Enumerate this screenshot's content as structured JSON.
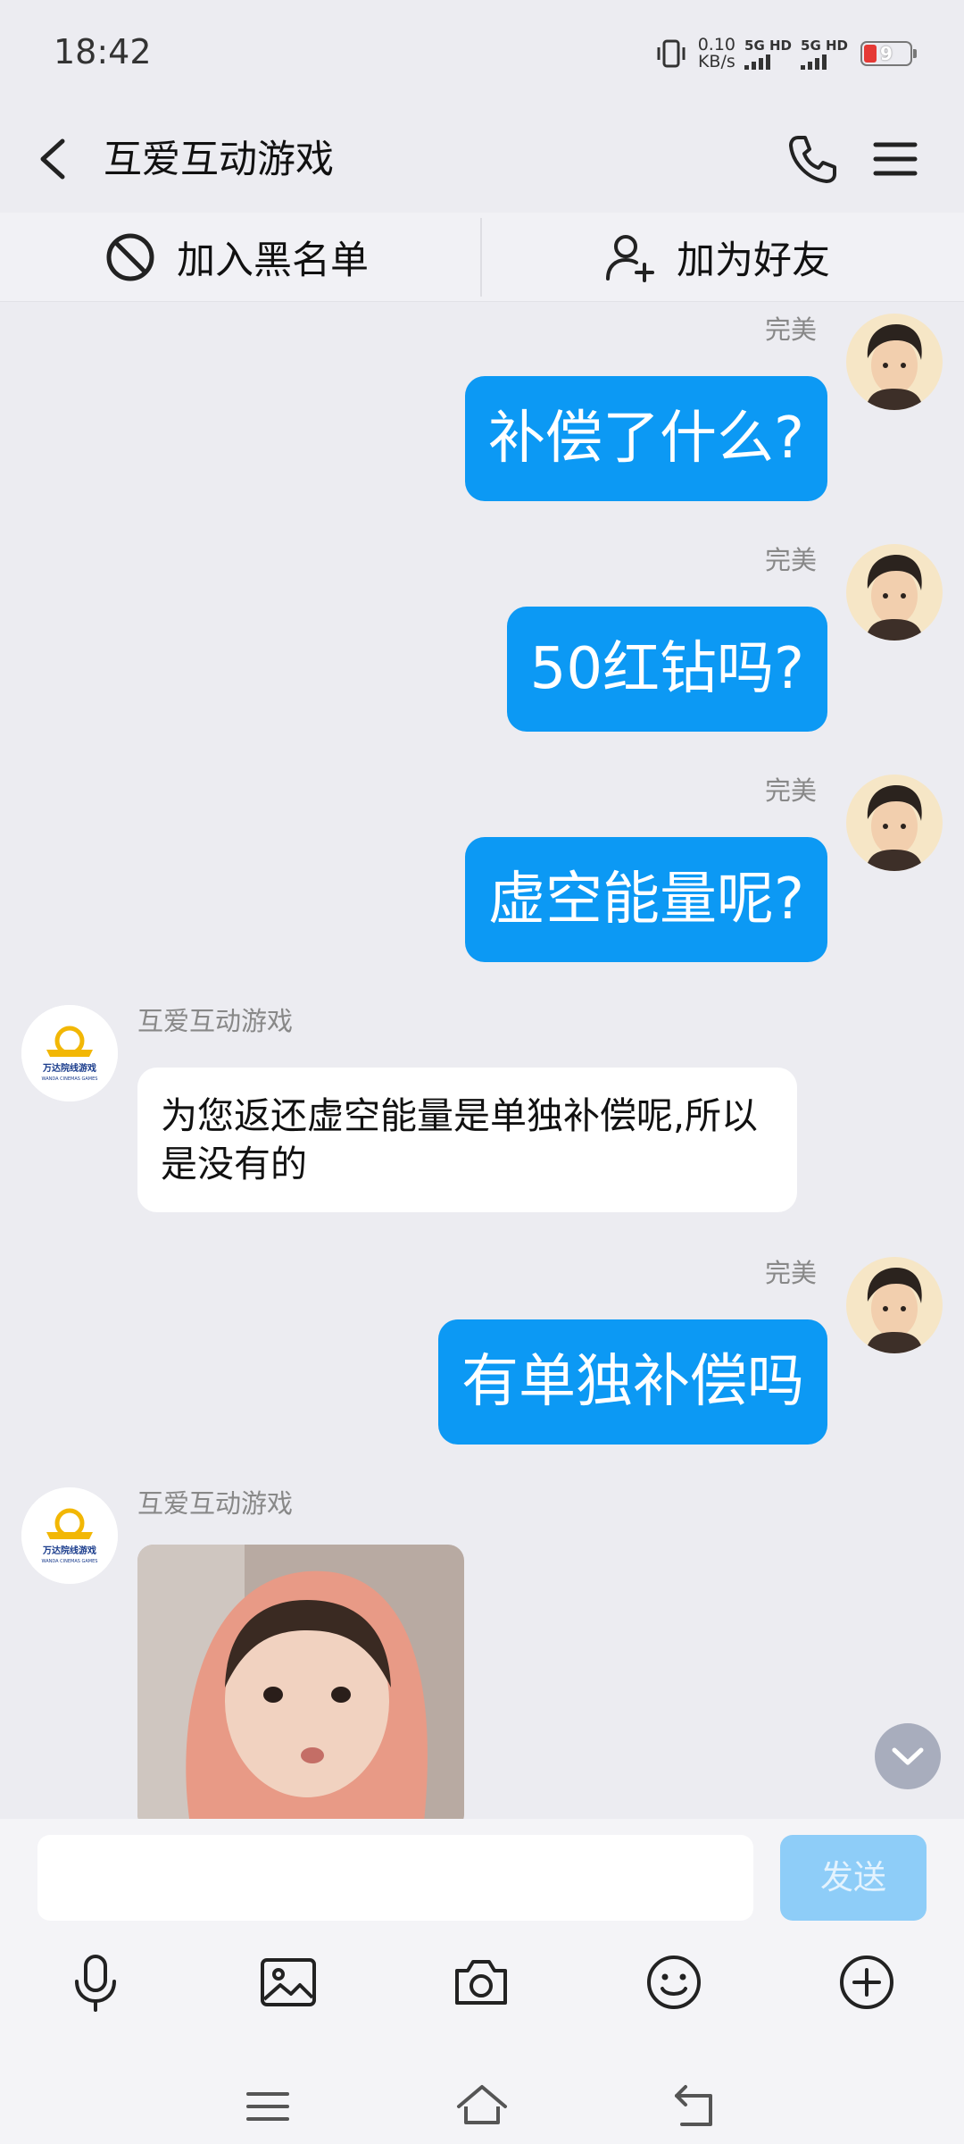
{
  "status_bar": {
    "time": "18:42",
    "net_speed_value": "0.10",
    "net_speed_unit": "KB/s",
    "sim1_label": "5G HD",
    "sim2_label": "5G HD",
    "battery_level": "9"
  },
  "header": {
    "title": "互爱互动游戏"
  },
  "actions": {
    "block_label": "加入黑名单",
    "add_friend_label": "加为好友"
  },
  "messages": [
    {
      "sender": "完美",
      "side": "me",
      "text": "补偿了什么?"
    },
    {
      "sender": "完美",
      "side": "me",
      "text": "50红钻吗?"
    },
    {
      "sender": "完美",
      "side": "me",
      "text": "虚空能量呢?"
    },
    {
      "sender": "互爱互动游戏",
      "side": "other",
      "text": "为您返还虚空能量是单独补偿呢,所以是没有的"
    },
    {
      "sender": "完美",
      "side": "me",
      "text": "有单独补偿吗"
    },
    {
      "sender": "互爱互动游戏",
      "side": "other",
      "type": "sticker"
    }
  ],
  "other_avatar_logo": {
    "text": "万达院线游戏",
    "subtext": "WANDA CINEMAS GAMES"
  },
  "input": {
    "value": "",
    "send_label": "发送"
  },
  "toolbar_icons": [
    "microphone-icon",
    "image-icon",
    "camera-icon",
    "emoji-icon",
    "plus-icon"
  ],
  "colors": {
    "accent_blue": "#0c99f4",
    "send_disabled": "#8ecdf8",
    "background": "#ececf1"
  }
}
